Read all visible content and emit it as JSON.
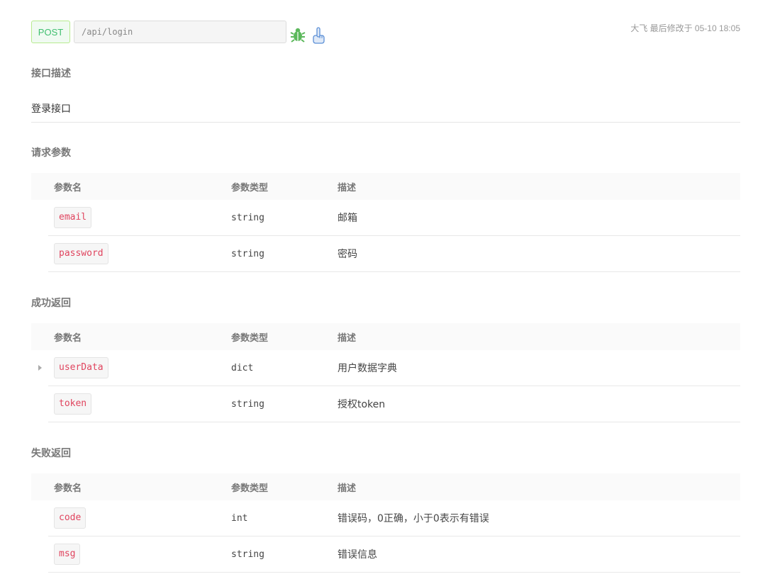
{
  "header": {
    "method": "POST",
    "url": "/api/login",
    "meta": "大飞 最后修改于 05-10 18:05"
  },
  "description": {
    "title": "接口描述",
    "text": "登录接口"
  },
  "columns": {
    "name": "参数名",
    "type": "参数类型",
    "desc": "描述"
  },
  "request": {
    "title": "请求参数",
    "rows": [
      {
        "name": "email",
        "type": "string",
        "desc": "邮箱"
      },
      {
        "name": "password",
        "type": "string",
        "desc": "密码"
      }
    ]
  },
  "success": {
    "title": "成功返回",
    "rows": [
      {
        "name": "userData",
        "type": "dict",
        "desc": "用户数据字典"
      },
      {
        "name": "token",
        "type": "string",
        "desc": "授权token"
      }
    ]
  },
  "failure": {
    "title": "失败返回",
    "rows": [
      {
        "name": "code",
        "type": "int",
        "desc": "错误码，0正确，小于0表示有错误"
      },
      {
        "name": "msg",
        "type": "string",
        "desc": "错误信息"
      }
    ]
  },
  "colors": {
    "method_green": "#3fbf6f",
    "param_red": "#e0445e",
    "debug_icon_green": "#5cb85c",
    "mock_icon_blue": "#5b8fd6"
  }
}
